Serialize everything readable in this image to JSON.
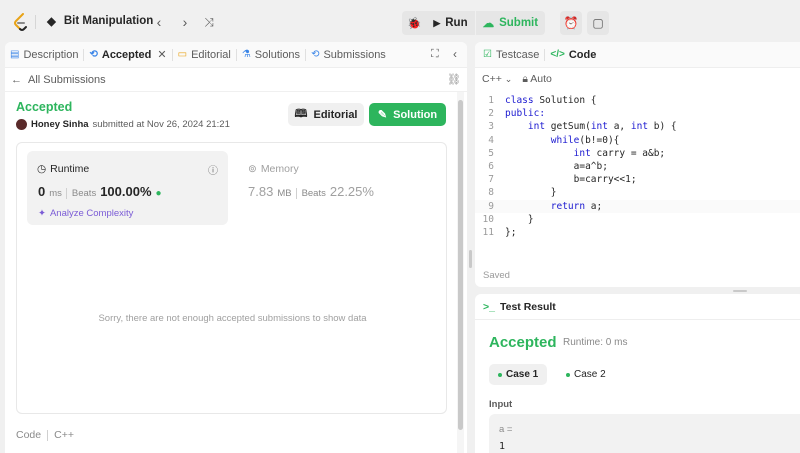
{
  "topbar": {
    "problem_list": "Bit Manipulation",
    "run_label": "Run",
    "submit_label": "Submit"
  },
  "left_panel": {
    "tabs": [
      {
        "label": "Description"
      },
      {
        "label": "Accepted"
      },
      {
        "label": "Editorial"
      },
      {
        "label": "Solutions"
      },
      {
        "label": "Submissions"
      }
    ],
    "back_label": "All Submissions",
    "status": "Accepted",
    "user": "Honey Sinha",
    "submitted_text": "submitted at Nov 26, 2024 21:21",
    "editorial_button": "Editorial",
    "solution_button": "Solution",
    "runtime": {
      "label": "Runtime",
      "value": "0",
      "unit": "ms",
      "beats_label": "Beats",
      "beats_value": "100.00%",
      "analyze": "Analyze Complexity"
    },
    "memory": {
      "label": "Memory",
      "value": "7.83",
      "unit": "MB",
      "beats_label": "Beats",
      "beats_value": "22.25%"
    },
    "empty_message": "Sorry, there are not enough accepted submissions to show data",
    "code_label": "Code",
    "code_lang": "C++"
  },
  "editor": {
    "tabs": [
      {
        "label": "Testcase"
      },
      {
        "label": "Code"
      }
    ],
    "language": "C++",
    "mode": "Auto",
    "lines": [
      {
        "n": "1",
        "kw": "class",
        "rest": " Solution {"
      },
      {
        "n": "2",
        "kw": "public:",
        "rest": ""
      },
      {
        "n": "3",
        "kw": "    int",
        "rest": " getSum(",
        "kw2": "int",
        "rest2": " a, ",
        "kw3": "int",
        "rest3": " b) {"
      },
      {
        "n": "4",
        "kw": "        while",
        "rest": "(b!=0){"
      },
      {
        "n": "5",
        "kw": "            int",
        "rest": " carry = a&b;"
      },
      {
        "n": "6",
        "kw": "",
        "rest": "            a=a^b;"
      },
      {
        "n": "7",
        "kw": "",
        "rest": "            b=carry<<1;"
      },
      {
        "n": "8",
        "kw": "",
        "rest": "        }"
      },
      {
        "n": "9",
        "kw": "        return",
        "rest": " a;"
      },
      {
        "n": "10",
        "kw": "",
        "rest": "    }"
      },
      {
        "n": "11",
        "kw": "",
        "rest": "};"
      }
    ],
    "saved": "Saved"
  },
  "result": {
    "title": "Test Result",
    "status": "Accepted",
    "runtime": "Runtime: 0 ms",
    "cases": [
      {
        "label": "Case 1"
      },
      {
        "label": "Case 2"
      }
    ],
    "input_label": "Input",
    "var_name": "a =",
    "var_value": "1"
  },
  "colors": {
    "accent_green": "#2db55d",
    "keyword_blue": "#1c1ad0",
    "analyze_purple": "#7b5cd6"
  }
}
